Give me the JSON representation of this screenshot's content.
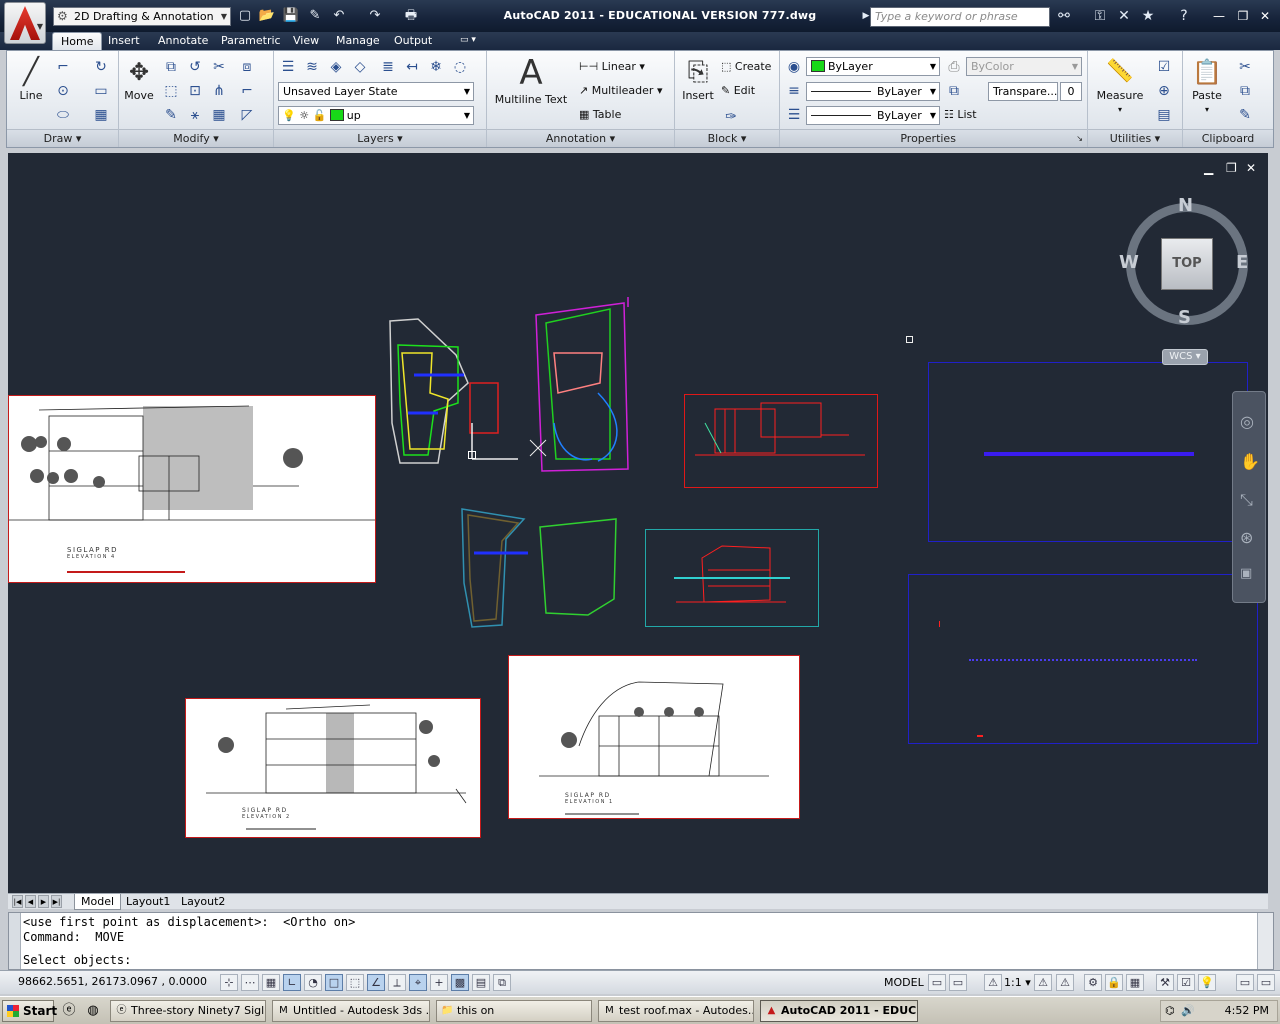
{
  "titlebar": {
    "workspace": "2D Drafting & Annotation",
    "title": "AutoCAD 2011 - EDUCATIONAL VERSION    777.dwg",
    "search_placeholder": "Type a keyword or phrase"
  },
  "ribbon": {
    "tabs": [
      "Home",
      "Insert",
      "Annotate",
      "Parametric",
      "View",
      "Manage",
      "Output"
    ],
    "active_tab": "Home",
    "panels": [
      "Draw",
      "Modify",
      "Layers",
      "Annotation",
      "Block",
      "Properties",
      "Utilities",
      "Clipboard"
    ],
    "draw": {
      "line_label": "Line"
    },
    "modify": {
      "move_label": "Move"
    },
    "layers": {
      "layer_state": "Unsaved Layer State",
      "current_layer": "up"
    },
    "annotation": {
      "multiline_text": "Multiline Text",
      "linear": "Linear",
      "multileader": "Multileader",
      "table": "Table"
    },
    "block": {
      "insert": "Insert",
      "create": "Create",
      "edit": "Edit"
    },
    "properties": {
      "color": "ByLayer",
      "linetype": "ByLayer",
      "lineweight": "ByLayer",
      "plot_style": "ByColor",
      "transparency": "Transpare...",
      "transparency_value": "0",
      "list": "List"
    },
    "utilities": {
      "measure": "Measure"
    },
    "clipboard": {
      "paste": "Paste"
    }
  },
  "canvas": {
    "viewcube": {
      "face": "TOP",
      "north": "N",
      "south": "S",
      "east": "E",
      "west": "W"
    },
    "wcs": "WCS",
    "sheets": [
      {
        "caption": "SIGLAP RD",
        "subcaption": "ELEVATION 4"
      },
      {
        "caption": "SIGLAP RD",
        "subcaption": "ELEVATION 2"
      },
      {
        "caption": "SIGLAP RD",
        "subcaption": "ELEVATION 1"
      }
    ]
  },
  "layout_tabs": [
    "Model",
    "Layout1",
    "Layout2"
  ],
  "command_line": {
    "history": [
      "<use first point as displacement>:  <Ortho on>",
      "Command:  MOVE"
    ],
    "prompt": "Select objects:"
  },
  "statusbar": {
    "coords": "98662.5651, 26173.0967 , 0.0000",
    "space": "MODEL",
    "scale": "1:1"
  },
  "taskbar": {
    "start": "Start",
    "tasks": [
      {
        "label": "Three-story Ninety7 Sigl...",
        "icon": "browser-icon"
      },
      {
        "label": "Untitled - Autodesk 3ds ...",
        "icon": "3dsmax-icon"
      },
      {
        "label": "this on",
        "icon": "folder-icon"
      },
      {
        "label": "test roof.max - Autodes...",
        "icon": "3dsmax-icon"
      },
      {
        "label": "AutoCAD 2011 - EDUC...",
        "icon": "autocad-icon"
      }
    ],
    "clock": "4:52 PM"
  }
}
